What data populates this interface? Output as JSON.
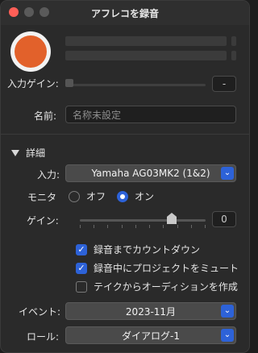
{
  "window": {
    "title": "アフレコを録音"
  },
  "meters": {
    "input_gain_value": "-"
  },
  "input_gain": {
    "label": "入力ゲイン:"
  },
  "name": {
    "label": "名前:",
    "placeholder": "名称未設定"
  },
  "details": {
    "label": "詳細",
    "input": {
      "label": "入力:",
      "value": "Yamaha AG03MK2 (1&2)"
    },
    "monitor": {
      "label": "モニタ",
      "off": "オフ",
      "on": "オン",
      "selected": "オン"
    },
    "gain": {
      "label": "ゲイン:",
      "value": "0"
    },
    "options": [
      {
        "label": "録音までカウントダウン",
        "checked": true
      },
      {
        "label": "録音中にプロジェクトをミュート",
        "checked": true
      },
      {
        "label": "テイクからオーディションを作成",
        "checked": false
      }
    ],
    "event": {
      "label": "イベント:",
      "value": "2023-11月"
    },
    "role": {
      "label": "ロール:",
      "value": "ダイアログ-1"
    }
  },
  "colors": {
    "record": "#e2612b",
    "accent": "#2d62d8"
  },
  "icons": {
    "close": "close-icon",
    "minimize": "minimize-icon",
    "zoom": "zoom-icon",
    "disclosure": "disclosure-triangle-icon",
    "chevron": "chevron-up-down-icon",
    "check": "checkmark-icon"
  }
}
